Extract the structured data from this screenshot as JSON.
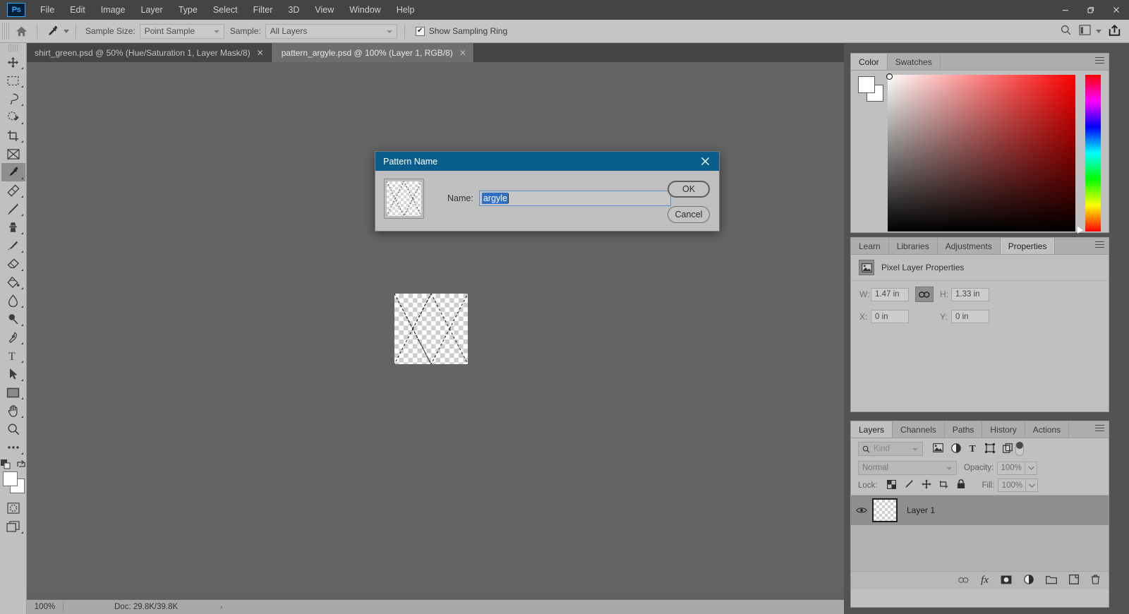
{
  "app": {
    "logo": "Ps",
    "title": "Adobe Photoshop"
  },
  "menubar": {
    "items": [
      "File",
      "Edit",
      "Image",
      "Layer",
      "Type",
      "Select",
      "Filter",
      "3D",
      "View",
      "Window",
      "Help"
    ]
  },
  "window_controls": {
    "minimize": "–",
    "restore": "❐",
    "close": "✕"
  },
  "options_bar": {
    "home_icon": "home-icon",
    "tool_icon": "eyedropper-icon",
    "sample_size_label": "Sample Size:",
    "sample_size_value": "Point Sample",
    "sample_label": "Sample:",
    "sample_value": "All Layers",
    "show_sampling_ring_label": "Show Sampling Ring",
    "show_sampling_ring_checked": true,
    "check_glyph": "✔",
    "right_icons": [
      "search-icon",
      "workspace-icon",
      "chevron-down-icon",
      "share-icon"
    ]
  },
  "tabs": {
    "chevron": "»",
    "items": [
      {
        "label": "shirt_green.psd @ 50% (Hue/Saturation 1, Layer Mask/8)",
        "active": false,
        "close": "✕"
      },
      {
        "label": "pattern_argyle.psd @ 100% (Layer 1, RGB/8)",
        "active": true,
        "close": "✕"
      }
    ]
  },
  "toolbar": {
    "tools": [
      {
        "name": "move-tool",
        "active": false
      },
      {
        "name": "rectangular-marquee-tool",
        "active": false
      },
      {
        "name": "lasso-tool",
        "active": false
      },
      {
        "name": "quick-selection-tool",
        "active": false
      },
      {
        "name": "crop-tool",
        "active": false
      },
      {
        "name": "frame-tool",
        "active": false
      },
      {
        "name": "eyedropper-tool",
        "active": true
      },
      {
        "name": "spot-healing-brush-tool",
        "active": false
      },
      {
        "name": "brush-tool",
        "active": false
      },
      {
        "name": "clone-stamp-tool",
        "active": false
      },
      {
        "name": "history-brush-tool",
        "active": false
      },
      {
        "name": "eraser-tool",
        "active": false
      },
      {
        "name": "gradient-tool",
        "active": false
      },
      {
        "name": "blur-tool",
        "active": false
      },
      {
        "name": "dodge-tool",
        "active": false
      },
      {
        "name": "pen-tool",
        "active": false
      },
      {
        "name": "type-tool",
        "active": false
      },
      {
        "name": "path-selection-tool",
        "active": false
      },
      {
        "name": "rectangle-tool",
        "active": false
      },
      {
        "name": "hand-tool",
        "active": false
      },
      {
        "name": "zoom-tool",
        "active": false
      },
      {
        "name": "edit-toolbar-tool",
        "active": false
      }
    ],
    "foreground_color": "#ffffff",
    "background_color": "#ffffff",
    "quick_mask_icon": "quick-mask-icon",
    "screen_mode_icon": "screen-mode-icon"
  },
  "dialog": {
    "title": "Pattern Name",
    "close": "✕",
    "name_label": "Name:",
    "name_value": "argyle",
    "ok_label": "OK",
    "cancel_label": "Cancel",
    "thumbnail_name": "pattern-preview-thumbnail"
  },
  "status_bar": {
    "zoom": "100%",
    "doc_info": "Doc: 29.8K/39.8K",
    "arrow": "›"
  },
  "panels": {
    "color": {
      "tabs": [
        {
          "label": "Color",
          "active": true
        },
        {
          "label": "Swatches",
          "active": false
        }
      ],
      "foreground_color": "#ffffff",
      "background_color": "#ffffff",
      "ramp_hue": "#ff0000"
    },
    "properties": {
      "tabs": [
        {
          "label": "Learn",
          "active": false
        },
        {
          "label": "Libraries",
          "active": false
        },
        {
          "label": "Adjustments",
          "active": false
        },
        {
          "label": "Properties",
          "active": true
        }
      ],
      "header_title": "Pixel Layer Properties",
      "w_label": "W:",
      "w_value": "1.47 in",
      "h_label": "H:",
      "h_value": "1.33 in",
      "x_label": "X:",
      "x_value": "0 in",
      "y_label": "Y:",
      "y_value": "0 in",
      "link_icon": "link-icon"
    },
    "layers": {
      "tabs": [
        {
          "label": "Layers",
          "active": true
        },
        {
          "label": "Channels",
          "active": false
        },
        {
          "label": "Paths",
          "active": false
        },
        {
          "label": "History",
          "active": false
        },
        {
          "label": "Actions",
          "active": false
        }
      ],
      "filter_kind": "Kind",
      "filter_icons": [
        "pixel-filter-icon",
        "adjustment-filter-icon",
        "type-filter-icon",
        "shape-filter-icon",
        "smart-object-filter-icon"
      ],
      "blend_mode": "Normal",
      "opacity_label": "Opacity:",
      "opacity_value": "100%",
      "lock_label": "Lock:",
      "lock_icons": [
        "lock-transparent-pixels-icon",
        "lock-image-pixels-icon",
        "lock-position-icon",
        "lock-artboard-icon",
        "lock-all-icon"
      ],
      "fill_label": "Fill:",
      "fill_value": "100%",
      "rows": [
        {
          "name": "Layer 1",
          "visible": true,
          "selected": true,
          "eye_icon": "eye-icon"
        }
      ],
      "footer_icons": [
        "link-layers-icon",
        "layer-style-icon",
        "layer-mask-icon",
        "adjustment-layer-icon",
        "new-group-icon",
        "new-layer-icon",
        "delete-layer-icon"
      ],
      "footer_fx_label": "fx"
    }
  }
}
